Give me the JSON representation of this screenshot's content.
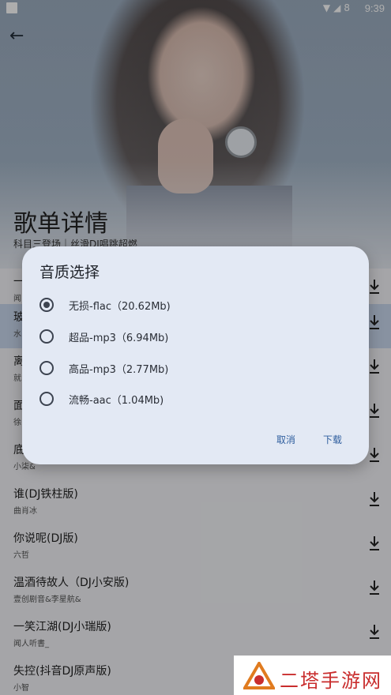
{
  "status_bar": {
    "time": "9:39",
    "battery": "8"
  },
  "header": {
    "title": "歌单详情",
    "subtitle": "科目三登场｜丝滑DJ唱跳超燃"
  },
  "songs": [
    {
      "name": "一",
      "artist": "闻"
    },
    {
      "name": "玻",
      "artist": "水"
    },
    {
      "name": "离",
      "artist": "就"
    },
    {
      "name": "面",
      "artist": "徐"
    },
    {
      "name": "底",
      "artist": "小柒&"
    },
    {
      "name": "谁(DJ铁柱版)",
      "artist": "曲肖冰"
    },
    {
      "name": "你说呢(DJ版)",
      "artist": "六哲"
    },
    {
      "name": "温酒待故人（DJ小安版)",
      "artist": "壹创剧音&李星航&"
    },
    {
      "name": "一笑江湖(DJ小瑞版)",
      "artist": "闻人听書_"
    },
    {
      "name": "失控(抖音DJ原声版)",
      "artist": "小智"
    }
  ],
  "dialog": {
    "title": "音质选择",
    "options": [
      {
        "label": "无损-flac（20.62Mb)",
        "selected": true
      },
      {
        "label": "超品-mp3（6.94Mb)",
        "selected": false
      },
      {
        "label": "高品-mp3（2.77Mb)",
        "selected": false
      },
      {
        "label": "流畅-aac（1.04Mb)",
        "selected": false
      }
    ],
    "cancel_label": "取消",
    "download_label": "下载"
  },
  "watermark": {
    "text": "二塔手游网"
  },
  "colors": {
    "accent": "#2f5e9e",
    "dialog_bg": "#e3e9f4",
    "highlight_row": "#c9d7ee",
    "watermark_red": "#c92d2d"
  }
}
